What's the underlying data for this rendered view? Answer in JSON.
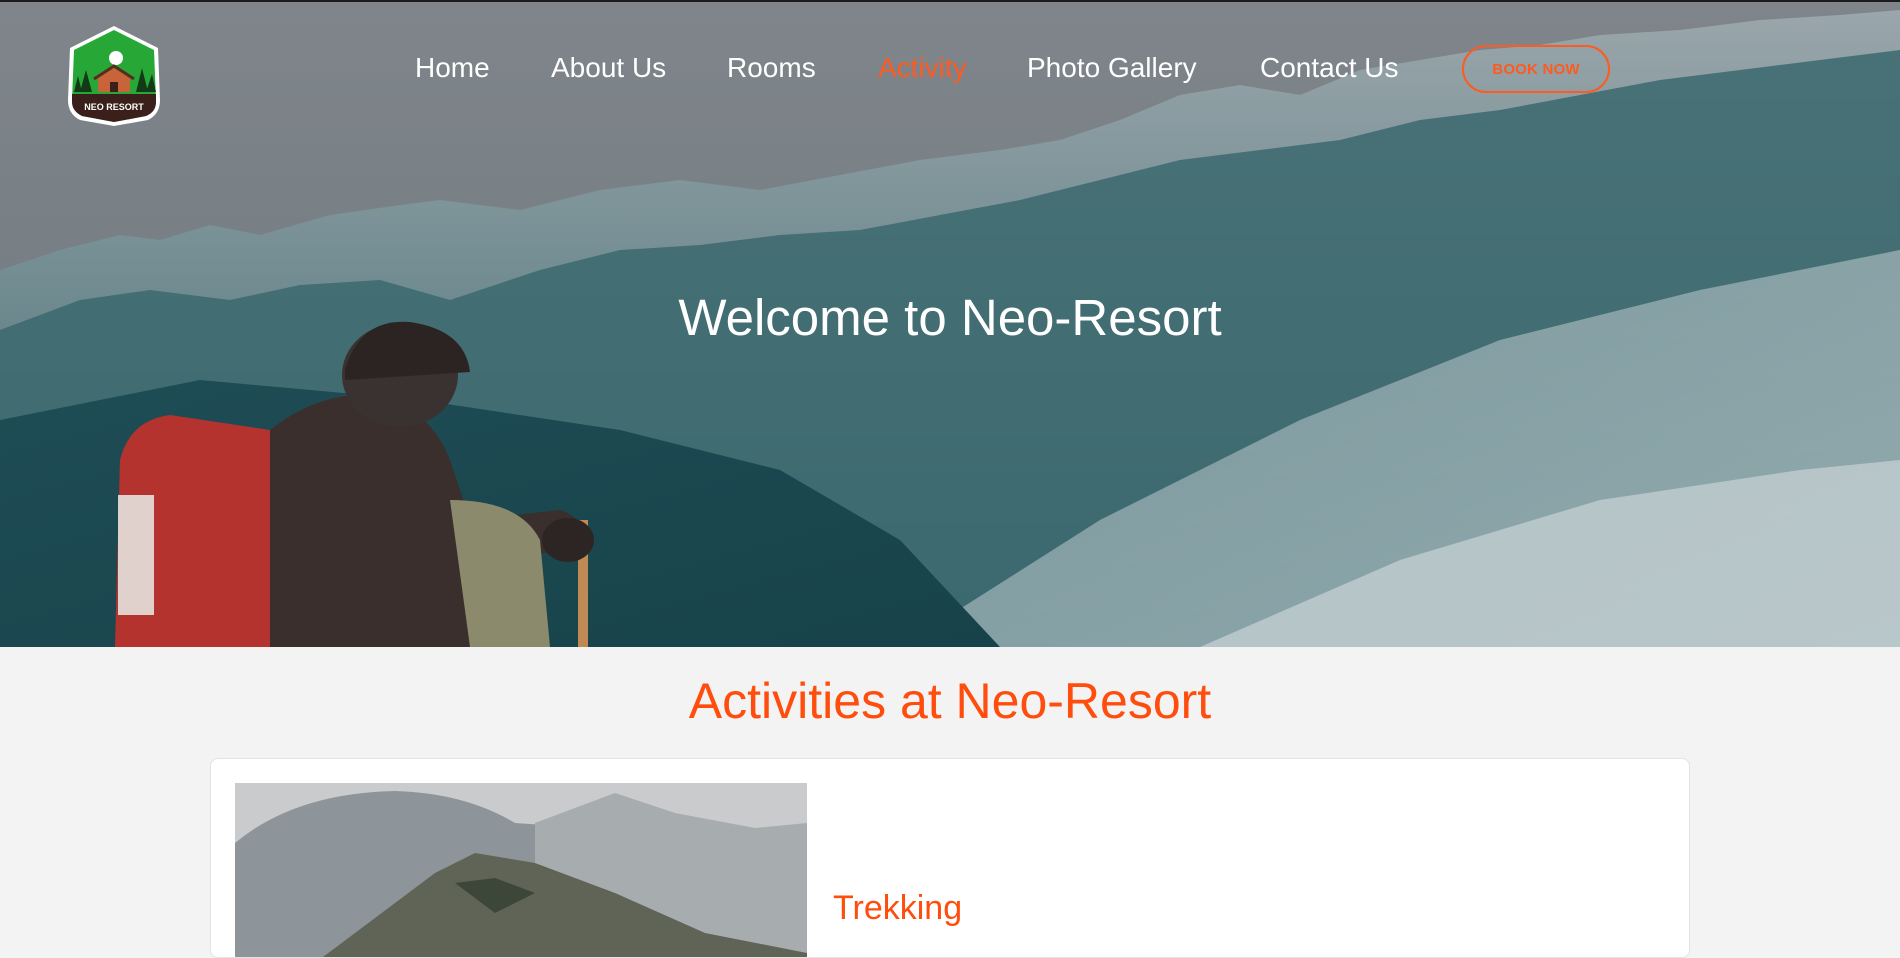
{
  "logo": {
    "text": "NEO RESORT",
    "icon": "cabin-forest-logo"
  },
  "nav": {
    "items": [
      {
        "label": "Home",
        "active": false
      },
      {
        "label": "About Us",
        "active": false
      },
      {
        "label": "Rooms",
        "active": false
      },
      {
        "label": "Activity",
        "active": true
      },
      {
        "label": "Photo Gallery",
        "active": false
      },
      {
        "label": "Contact Us",
        "active": false
      }
    ],
    "book_label": "BOOK NOW"
  },
  "hero": {
    "title": "Welcome to Neo-Resort"
  },
  "activities": {
    "heading": "Activities at Neo-Resort",
    "items": [
      {
        "title": "Trekking"
      }
    ]
  },
  "colors": {
    "accent": "#ff5a1f",
    "heading": "#ff4d0d",
    "page_bg": "#f3f3f3"
  }
}
